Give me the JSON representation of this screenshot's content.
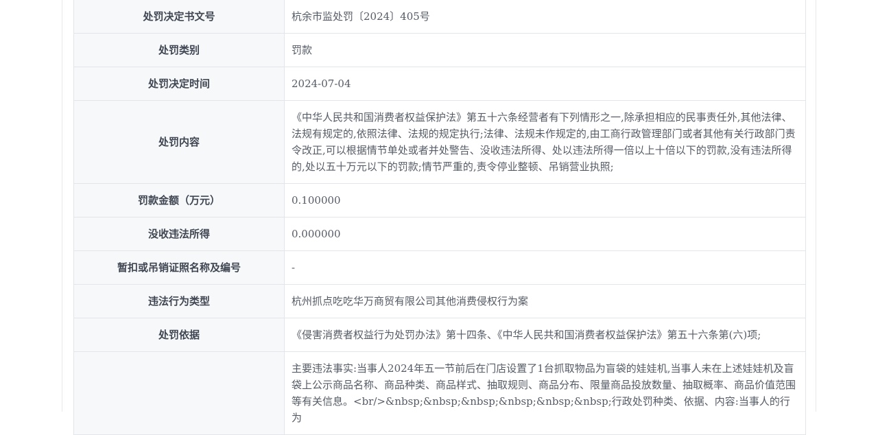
{
  "rows": [
    {
      "label": "处罚决定书文号",
      "value": "杭余市监处罚〔2024〕405号"
    },
    {
      "label": "处罚类别",
      "value": "罚款"
    },
    {
      "label": "处罚决定时间",
      "value": "2024-07-04"
    },
    {
      "label": "处罚内容",
      "value": "《中华人民共和国消费者权益保护法》第五十六条经营者有下列情形之一,除承担相应的民事责任外,其他法律、法规有规定的,依照法律、法规的规定执行;法律、法规未作规定的,由工商行政管理部门或者其他有关行政部门责令改正,可以根据情节单处或者并处警告、没收违法所得、处以违法所得一倍以上十倍以下的罚款,没有违法所得的,处以五十万元以下的罚款;情节严重的,责令停业整顿、吊销营业执照;"
    },
    {
      "label": "罚款金额（万元）",
      "value": "0.100000"
    },
    {
      "label": "没收违法所得",
      "value": "0.000000"
    },
    {
      "label": "暂扣或吊销证照名称及编号",
      "value": "-"
    },
    {
      "label": "违法行为类型",
      "value": "杭州抓点吃吃华万商贸有限公司其他消费侵权行为案"
    },
    {
      "label": "处罚依据",
      "value": "《侵害消费者权益行为处罚办法》第十四条、《中华人民共和国消费者权益保护法》第五十六条第(六)项;"
    },
    {
      "label": "",
      "value": "主要违法事实:当事人2024年五一节前后在门店设置了1台抓取物品为盲袋的娃娃机,当事人未在上述娃娃机及盲袋上公示商品名称、商品种类、商品样式、抽取规则、商品分布、限量商品投放数量、抽取概率、商品价值范围等有关信息。<br/>&nbsp;&nbsp;&nbsp;&nbsp;&nbsp;&nbsp;行政处罚种类、依据、内容:当事人的行为"
    }
  ]
}
